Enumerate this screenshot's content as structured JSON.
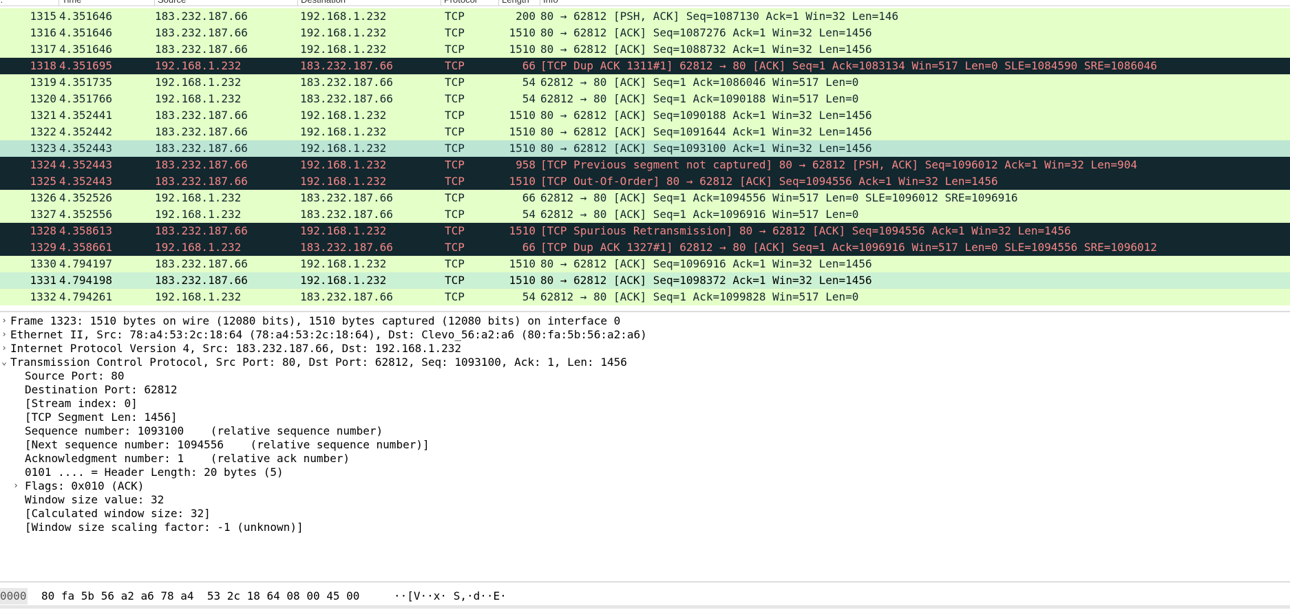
{
  "columns": [
    "No.",
    "Time",
    "Source",
    "Destination",
    "Protocol",
    "Length",
    "Info"
  ],
  "packets": [
    {
      "no": "1315",
      "time": "4.351646",
      "src": "183.232.187.66",
      "dst": "192.168.1.232",
      "proto": "TCP",
      "len": "200",
      "info": "80 → 62812 [PSH, ACK] Seq=1087130 Ack=1 Win=32 Len=146",
      "style": "green"
    },
    {
      "no": "1316",
      "time": "4.351646",
      "src": "183.232.187.66",
      "dst": "192.168.1.232",
      "proto": "TCP",
      "len": "1510",
      "info": "80 → 62812 [ACK] Seq=1087276 Ack=1 Win=32 Len=1456",
      "style": "green"
    },
    {
      "no": "1317",
      "time": "4.351646",
      "src": "183.232.187.66",
      "dst": "192.168.1.232",
      "proto": "TCP",
      "len": "1510",
      "info": "80 → 62812 [ACK] Seq=1088732 Ack=1 Win=32 Len=1456",
      "style": "green"
    },
    {
      "no": "1318",
      "time": "4.351695",
      "src": "192.168.1.232",
      "dst": "183.232.187.66",
      "proto": "TCP",
      "len": "66",
      "info": "[TCP Dup ACK 1311#1] 62812 → 80 [ACK] Seq=1 Ack=1083134 Win=517 Len=0 SLE=1084590 SRE=1086046",
      "style": "black"
    },
    {
      "no": "1319",
      "time": "4.351735",
      "src": "192.168.1.232",
      "dst": "183.232.187.66",
      "proto": "TCP",
      "len": "54",
      "info": "62812 → 80 [ACK] Seq=1 Ack=1086046 Win=517 Len=0",
      "style": "green"
    },
    {
      "no": "1320",
      "time": "4.351766",
      "src": "192.168.1.232",
      "dst": "183.232.187.66",
      "proto": "TCP",
      "len": "54",
      "info": "62812 → 80 [ACK] Seq=1 Ack=1090188 Win=517 Len=0",
      "style": "green"
    },
    {
      "no": "1321",
      "time": "4.352441",
      "src": "183.232.187.66",
      "dst": "192.168.1.232",
      "proto": "TCP",
      "len": "1510",
      "info": "80 → 62812 [ACK] Seq=1090188 Ack=1 Win=32 Len=1456",
      "style": "green"
    },
    {
      "no": "1322",
      "time": "4.352442",
      "src": "183.232.187.66",
      "dst": "192.168.1.232",
      "proto": "TCP",
      "len": "1510",
      "info": "80 → 62812 [ACK] Seq=1091644 Ack=1 Win=32 Len=1456",
      "style": "green"
    },
    {
      "no": "1323",
      "time": "4.352443",
      "src": "183.232.187.66",
      "dst": "192.168.1.232",
      "proto": "TCP",
      "len": "1510",
      "info": "80 → 62812 [ACK] Seq=1093100 Ack=1 Win=32 Len=1456",
      "style": "selected"
    },
    {
      "no": "1324",
      "time": "4.352443",
      "src": "183.232.187.66",
      "dst": "192.168.1.232",
      "proto": "TCP",
      "len": "958",
      "info": "[TCP Previous segment not captured] 80 → 62812 [PSH, ACK] Seq=1096012 Ack=1 Win=32 Len=904",
      "style": "black"
    },
    {
      "no": "1325",
      "time": "4.352443",
      "src": "183.232.187.66",
      "dst": "192.168.1.232",
      "proto": "TCP",
      "len": "1510",
      "info": "[TCP Out-Of-Order] 80 → 62812 [ACK] Seq=1094556 Ack=1 Win=32 Len=1456",
      "style": "black"
    },
    {
      "no": "1326",
      "time": "4.352526",
      "src": "192.168.1.232",
      "dst": "183.232.187.66",
      "proto": "TCP",
      "len": "66",
      "info": "62812 → 80 [ACK] Seq=1 Ack=1094556 Win=517 Len=0 SLE=1096012 SRE=1096916",
      "style": "green"
    },
    {
      "no": "1327",
      "time": "4.352556",
      "src": "192.168.1.232",
      "dst": "183.232.187.66",
      "proto": "TCP",
      "len": "54",
      "info": "62812 → 80 [ACK] Seq=1 Ack=1096916 Win=517 Len=0",
      "style": "green"
    },
    {
      "no": "1328",
      "time": "4.358613",
      "src": "183.232.187.66",
      "dst": "192.168.1.232",
      "proto": "TCP",
      "len": "1510",
      "info": "[TCP Spurious Retransmission] 80 → 62812 [ACK] Seq=1094556 Ack=1 Win=32 Len=1456",
      "style": "black"
    },
    {
      "no": "1329",
      "time": "4.358661",
      "src": "192.168.1.232",
      "dst": "183.232.187.66",
      "proto": "TCP",
      "len": "66",
      "info": "[TCP Dup ACK 1327#1] 62812 → 80 [ACK] Seq=1 Ack=1096916 Win=517 Len=0 SLE=1094556 SRE=1096012",
      "style": "black"
    },
    {
      "no": "1330",
      "time": "4.794197",
      "src": "183.232.187.66",
      "dst": "192.168.1.232",
      "proto": "TCP",
      "len": "1510",
      "info": "80 → 62812 [ACK] Seq=1096916 Ack=1 Win=32 Len=1456",
      "style": "green"
    },
    {
      "no": "1331",
      "time": "4.794198",
      "src": "183.232.187.66",
      "dst": "192.168.1.232",
      "proto": "TCP",
      "len": "1510",
      "info": "80 → 62812 [ACK] Seq=1098372 Ack=1 Win=32 Len=1456",
      "style": "alt"
    },
    {
      "no": "1332",
      "time": "4.794261",
      "src": "192.168.1.232",
      "dst": "183.232.187.66",
      "proto": "TCP",
      "len": "54",
      "info": "62812 → 80 [ACK] Seq=1 Ack=1099828 Win=517 Len=0",
      "style": "green"
    }
  ],
  "details": [
    {
      "text": "Frame 1323: 1510 bytes on wire (12080 bits), 1510 bytes captured (12080 bits) on interface 0",
      "level": 0,
      "twisty": "collapsed"
    },
    {
      "text": "Ethernet II, Src: 78:a4:53:2c:18:64 (78:a4:53:2c:18:64), Dst: Clevo_56:a2:a6 (80:fa:5b:56:a2:a6)",
      "level": 0,
      "twisty": "collapsed"
    },
    {
      "text": "Internet Protocol Version 4, Src: 183.232.187.66, Dst: 192.168.1.232",
      "level": 0,
      "twisty": "collapsed"
    },
    {
      "text": "Transmission Control Protocol, Src Port: 80, Dst Port: 62812, Seq: 1093100, Ack: 1, Len: 1456",
      "level": 0,
      "twisty": "expanded"
    },
    {
      "text": "Source Port: 80",
      "level": 1,
      "twisty": "none"
    },
    {
      "text": "Destination Port: 62812",
      "level": 1,
      "twisty": "none"
    },
    {
      "text": "[Stream index: 0]",
      "level": 1,
      "twisty": "none"
    },
    {
      "text": "[TCP Segment Len: 1456]",
      "level": 1,
      "twisty": "none"
    },
    {
      "text": "Sequence number: 1093100    (relative sequence number)",
      "level": 1,
      "twisty": "none"
    },
    {
      "text": "[Next sequence number: 1094556    (relative sequence number)]",
      "level": 1,
      "twisty": "none"
    },
    {
      "text": "Acknowledgment number: 1    (relative ack number)",
      "level": 1,
      "twisty": "none"
    },
    {
      "text": "0101 .... = Header Length: 20 bytes (5)",
      "level": 1,
      "twisty": "none"
    },
    {
      "text": "Flags: 0x010 (ACK)",
      "level": 1,
      "twisty": "collapsed"
    },
    {
      "text": "Window size value: 32",
      "level": 1,
      "twisty": "none"
    },
    {
      "text": "[Calculated window size: 32]",
      "level": 1,
      "twisty": "none"
    },
    {
      "text": "[Window size scaling factor: -1 (unknown)]",
      "level": 1,
      "twisty": "none"
    }
  ],
  "bytes": {
    "offset": "0000",
    "hex": "80 fa 5b 56 a2 a6 78 a4  53 2c 18 64 08 00 45 00",
    "ascii": "··[V··x· S,·d··E·"
  },
  "twisty_icons": {
    "collapsed": "›",
    "expanded": "⌄"
  },
  "colors": {
    "green_row": "#e4ffc7",
    "selected_row": "#bce5d4",
    "alt_row": "#cbf1d4",
    "black_row_bg": "#12272e",
    "black_row_fg": "#f78787"
  }
}
